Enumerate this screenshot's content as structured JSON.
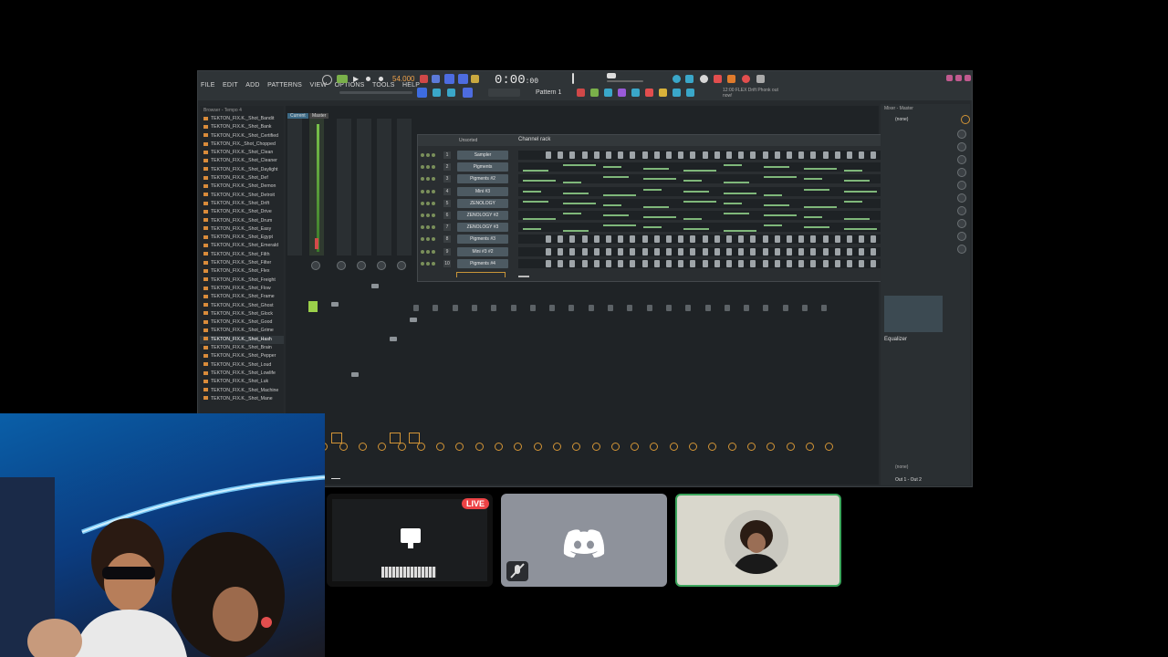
{
  "daw": {
    "menus": [
      "FILE",
      "EDIT",
      "ADD",
      "PATTERNS",
      "VIEW",
      "OPTIONS",
      "TOOLS",
      "HELP"
    ],
    "tempo": "54.000",
    "time": "0:00",
    "time_sub": ":00",
    "pattern": "Pattern 1",
    "hint": "12:00 FLEX Drift Phonk out now!",
    "browser_title": "Browser - Tempo 4",
    "browser_items": [
      "TEKTON_FIX.K._Shot_Bandit",
      "TEKTON_FIX.K._Shot_Bank",
      "TEKTON_FIX.K._Shot_Certified",
      "TEKTON_FIX._Shot_Chopped",
      "TEKTON_FIX.K._Shot_Clean",
      "TEKTON_FIX.K._Shot_Cleaner",
      "TEKTON_FIX.K._Shot_Daylight",
      "TEKTON_FIX.K._Shot_Def",
      "TEKTON_FIX.K._Shot_Demon",
      "TEKTON_FIX.K._Shot_Detroit",
      "TEKTON_FIX.K._Shot_Drift",
      "TEKTON_FIX.K._Shot_Drive",
      "TEKTON_FIX.K._Shot_Drum",
      "TEKTON_FIX.K._Shot_Easy",
      "TEKTON_FIX.K._Shot_Egypt",
      "TEKTON_FIX.K._Shot_Emerald",
      "TEKTON_FIX.K._Shot_Filth",
      "TEKTON_FIX.K._Shot_Filter",
      "TEKTON_FIX.K._Shot_Flex",
      "TEKTON_FIX.K._Shot_Freight",
      "TEKTON_FIX.K._Shot_Flow",
      "TEKTON_FIX.K._Shot_Frame",
      "TEKTON_FIX.K._Shot_Ghost",
      "TEKTON_FIX.K._Shot_Glock",
      "TEKTON_FIX.K._Shot_Good",
      "TEKTON_FIX.K._Shot_Grime",
      "TEKTON_FIX.K._Shot_Hash",
      "TEKTON_FIX.K._Shot_Brain",
      "TEKTON_FIX.K._Shot_Pepper",
      "TEKTON_FIX.K._Shot_Loud",
      "TEKTON_FIX.K._Shot_Lowlife",
      "TEKTON_FIX.K._Shot_Luk",
      "TEKTON_FIX.K._Shot_Machine",
      "TEKTON_FIX.K._Shot_Mane"
    ],
    "browser_selected_index": 26,
    "rack_title": "Channel rack",
    "rack_filter": "Unsorted",
    "channels": [
      {
        "num": "1",
        "name": "Sampler"
      },
      {
        "num": "2",
        "name": "Pigments"
      },
      {
        "num": "3",
        "name": "Pigments #2"
      },
      {
        "num": "4",
        "name": "Mini #3"
      },
      {
        "num": "5",
        "name": "ZENOLOGY"
      },
      {
        "num": "6",
        "name": "ZENOLOGY #2"
      },
      {
        "num": "7",
        "name": "ZENOLOGY #3"
      },
      {
        "num": "8",
        "name": "Pigments #3"
      },
      {
        "num": "9",
        "name": "Mini #3 #2"
      },
      {
        "num": "10",
        "name": "Pigments #4"
      }
    ],
    "mixer_tabs": [
      "Current",
      "Master"
    ],
    "inspector_title": "Mixer - Master",
    "inspector_slot": "(none)",
    "inspector_fx": "Equalizer",
    "inspector_out_none": "(none)",
    "inspector_out": "Out 1 - Out 2"
  },
  "call": {
    "live_badge": "LIVE"
  }
}
